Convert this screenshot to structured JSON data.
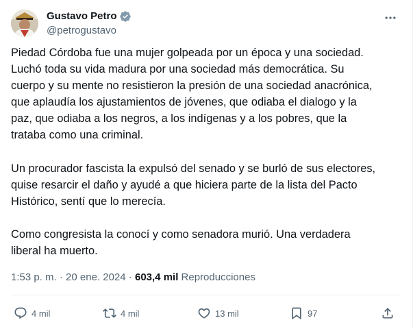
{
  "author": {
    "display_name": "Gustavo Petro",
    "handle": "@petrogustavo",
    "verified_color": "#829aab"
  },
  "tweet": {
    "paragraphs": [
      "Piedad Córdoba fue una mujer golpeada por un época y una sociedad.\nLuchó toda su vida madura  por una sociedad más democrática. Su\ncuerpo y su mente no resistieron la presión de una sociedad anacrónica,\nque aplaudía los ajustamientos de jóvenes, que odiaba el dialogo y la\npaz, que odiaba a los negros, a los indígenas y a los pobres, que la\ntrataba como una criminal.",
      "Un procurador fascista la expulsó del senado y se burló de sus electores,\nquise resarcir el daño y ayudé a que hiciera parte de la lista del Pacto\nHistórico, sentí que lo merecía.",
      "Como congresista la conocí y como senadora murió. Una verdadera\nliberal ha muerto."
    ]
  },
  "meta": {
    "time": "1:53 p. m.",
    "separator": " · ",
    "date": "20 ene. 2024",
    "views_count": "603,4 mil",
    "views_label": "Reproducciones"
  },
  "actions": {
    "replies": "4 mil",
    "retweets": "4 mil",
    "likes": "13 mil",
    "bookmarks": "97"
  },
  "colors": {
    "text": "#0f1419",
    "secondary": "#536471",
    "divider": "#eff3f4"
  }
}
